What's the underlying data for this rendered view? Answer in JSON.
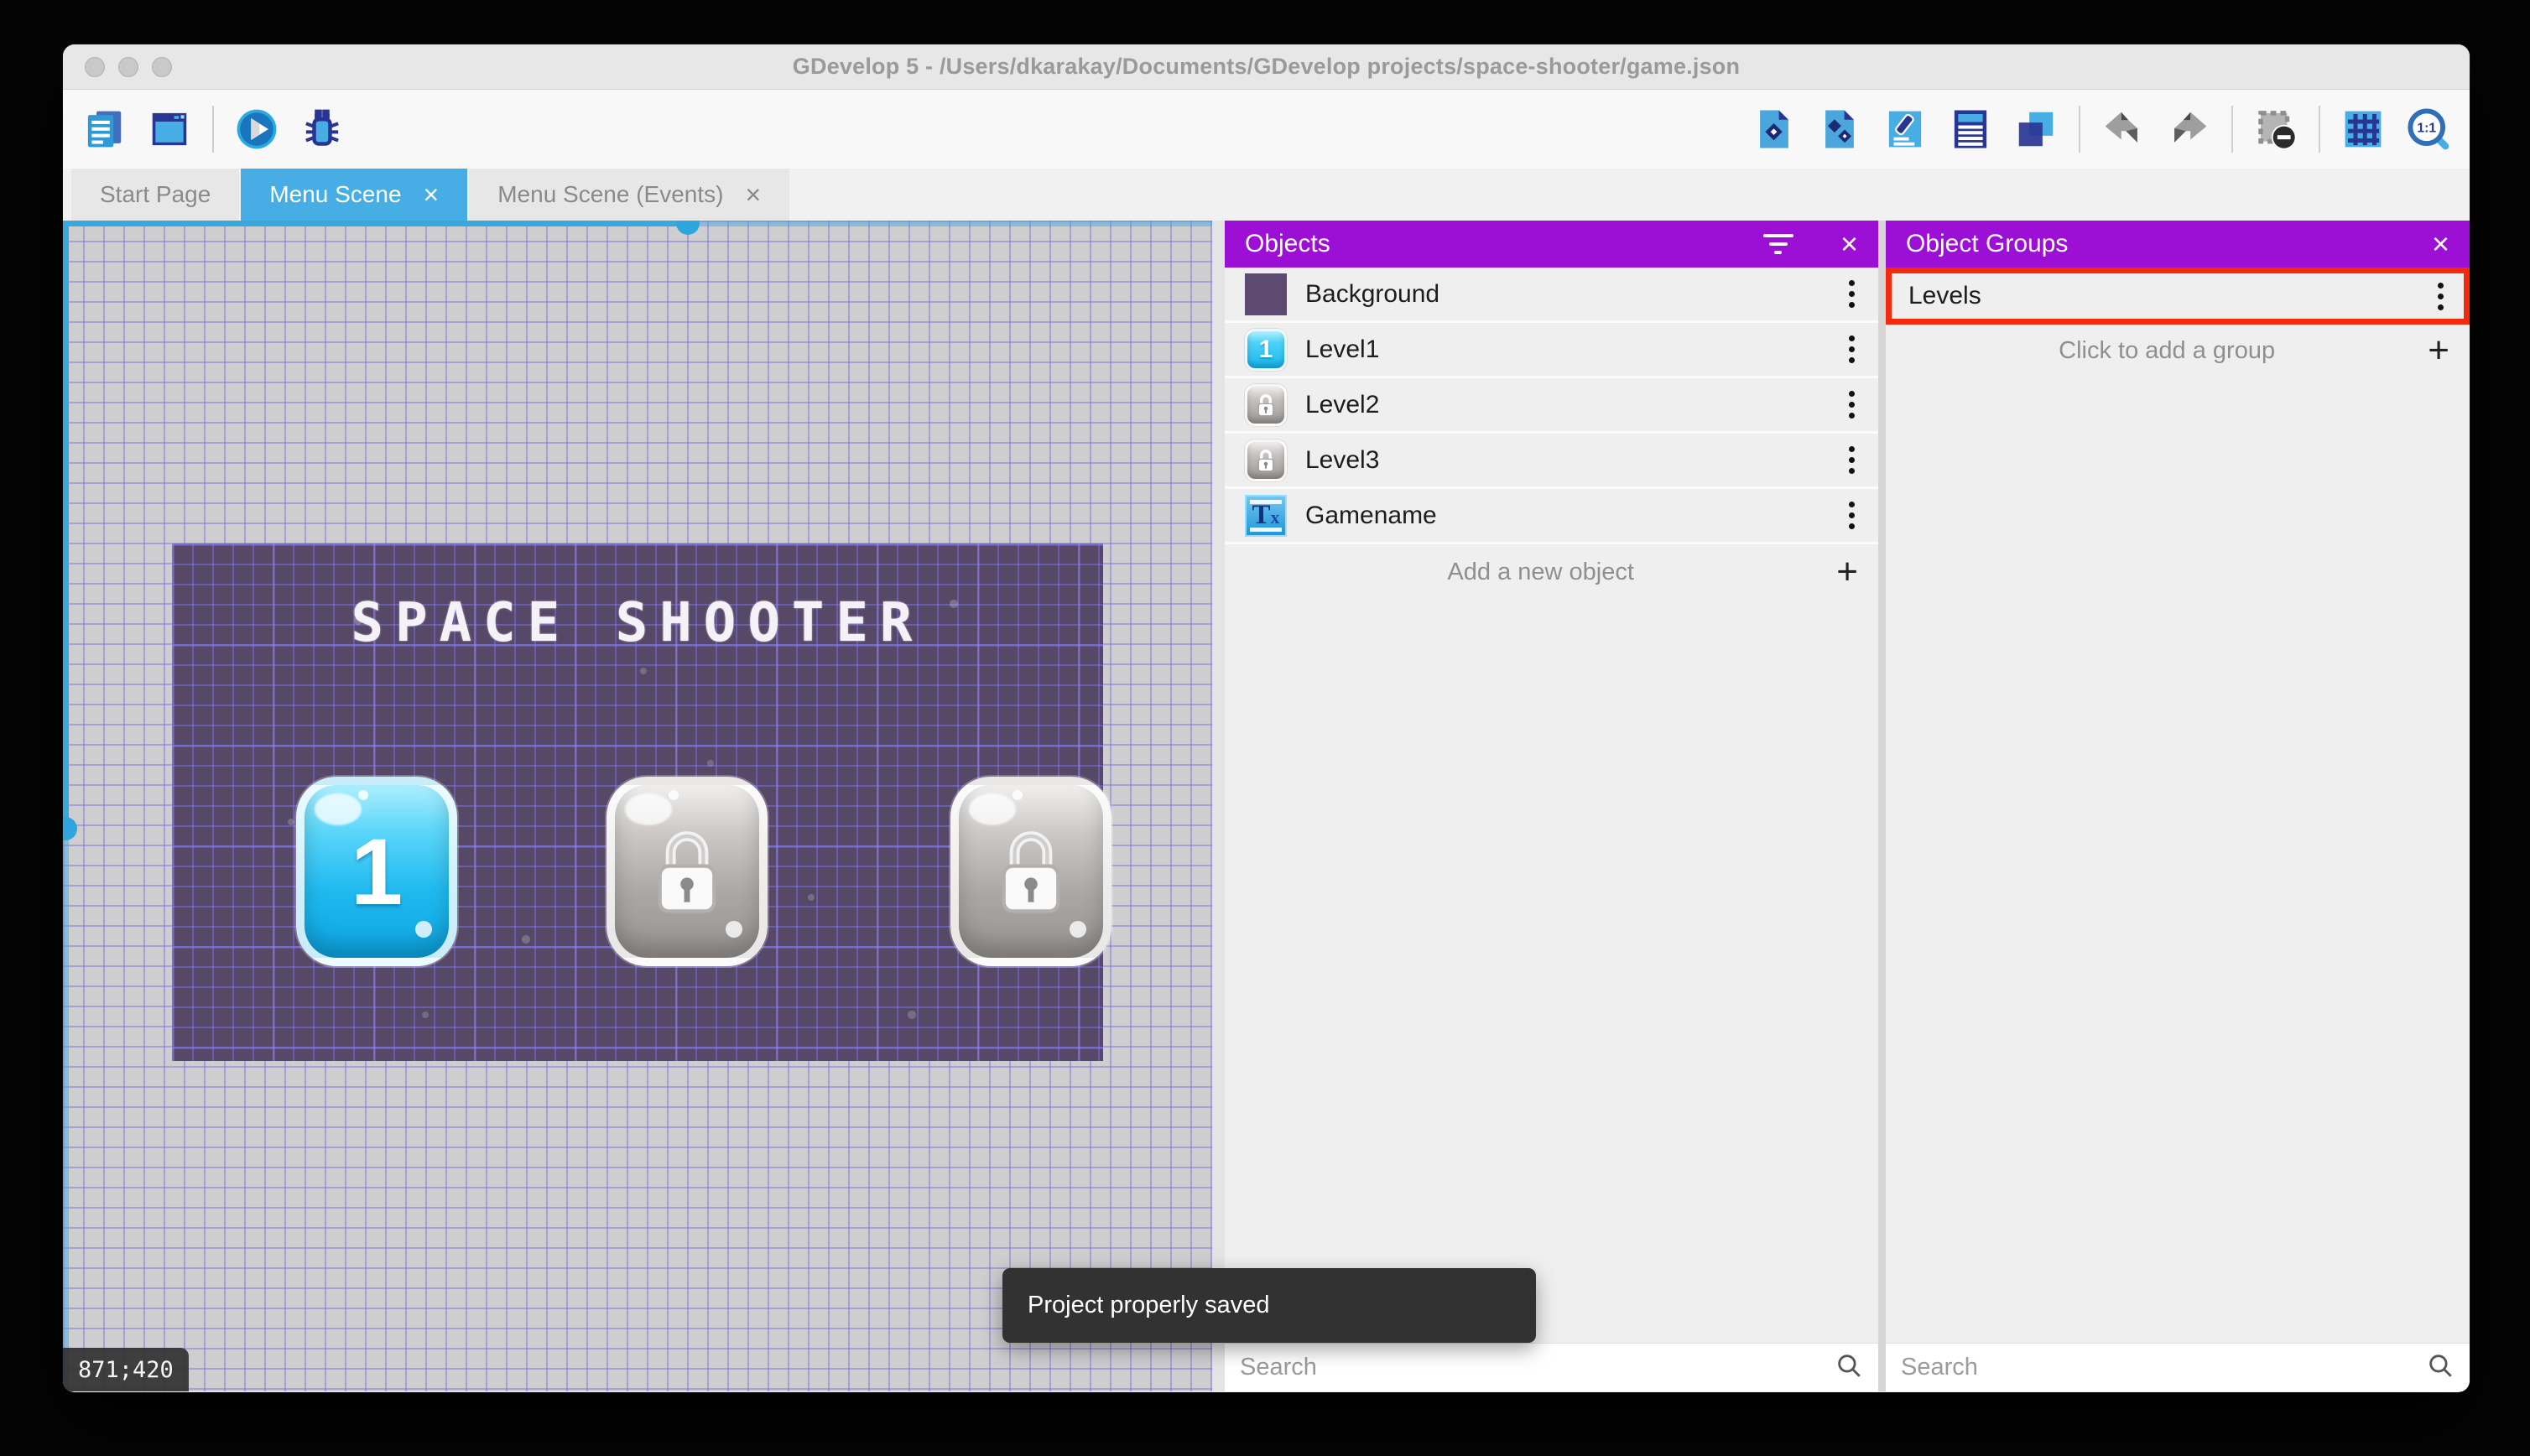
{
  "window": {
    "title": "GDevelop 5 - /Users/dkarakay/Documents/GDevelop projects/space-shooter/game.json"
  },
  "toolbar": {
    "left_icons": [
      "project-manager",
      "scene-editor-window",
      "preview-play",
      "debug"
    ],
    "right_icons": [
      "objects-editor",
      "object-groups-editor",
      "properties",
      "instances-list",
      "layers",
      "undo",
      "redo",
      "deselect-instances",
      "toggle-grid",
      "zoom-1-1"
    ]
  },
  "tabs": [
    {
      "label": "Start Page",
      "active": false
    },
    {
      "label": "Menu Scene",
      "active": true
    },
    {
      "label": "Menu Scene (Events)",
      "active": false
    }
  ],
  "glyphs": {
    "close": "×",
    "plus": "+"
  },
  "canvas": {
    "coordinates": "871;420",
    "scene": {
      "title": "SPACE SHOOTER",
      "level_buttons": [
        {
          "label": "1",
          "state": "unlocked"
        },
        {
          "label": "",
          "state": "locked"
        },
        {
          "label": "",
          "state": "locked"
        }
      ]
    }
  },
  "objects_panel": {
    "title": "Objects",
    "items": [
      {
        "name": "Background",
        "icon": "background-thumbnail"
      },
      {
        "name": "Level1",
        "icon": "level1-button-thumbnail"
      },
      {
        "name": "Level2",
        "icon": "locked-button-thumbnail"
      },
      {
        "name": "Level3",
        "icon": "locked-button-thumbnail"
      },
      {
        "name": "Gamename",
        "icon": "text-object-thumbnail"
      }
    ],
    "add_label": "Add a new object",
    "search_placeholder": "Search"
  },
  "groups_panel": {
    "title": "Object Groups",
    "items": [
      {
        "name": "Levels",
        "highlighted": true
      }
    ],
    "add_label": "Click to add a group",
    "search_placeholder": "Search"
  },
  "toast": {
    "message": "Project properly saved"
  },
  "colors": {
    "panel_header": "#9c10d6",
    "active_tab": "#47aee5",
    "highlight_border": "#f32a0c",
    "scene_background": "#574868",
    "window_border_blue": "#3aa7dd"
  },
  "text_object_glyph": {
    "t": "T",
    "x": "x"
  }
}
